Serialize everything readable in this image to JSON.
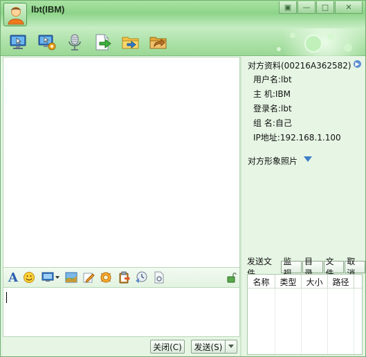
{
  "window": {
    "title": "lbt(IBM)",
    "controls": [
      "minimize-restore",
      "minimize",
      "maximize",
      "close"
    ]
  },
  "toolbar": {
    "icons": [
      "remote-desktop-icon",
      "remote-assist-icon",
      "microphone-icon",
      "send-file-icon",
      "send-folder-icon",
      "share-folder-icon"
    ]
  },
  "peer_info": {
    "title": "对方资料(00216A362582)",
    "username_line": "用户名:lbt",
    "host_line": "主  机:IBM",
    "login_line": "登录名:lbt",
    "group_line": "组  名:自己",
    "ip_line": "IP地址:192.168.1.100"
  },
  "photo": {
    "title": "对方形象照片"
  },
  "file_transfer": {
    "label": "发送文件",
    "buttons": [
      "监视",
      "目录",
      "文件",
      "取消"
    ],
    "columns": [
      "名称",
      "类型",
      "大小",
      "路径"
    ]
  },
  "input": {
    "close_label": "关闭(C)",
    "send_label": "发送(S)"
  },
  "colors": {
    "accent_green": "#8ed48a",
    "panel_bg": "#e6f5e4"
  }
}
